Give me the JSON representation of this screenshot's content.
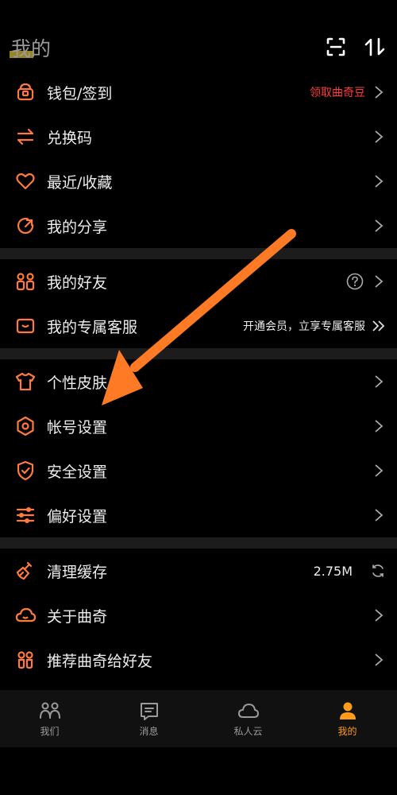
{
  "header": {
    "title": "我的",
    "scan_icon": "scan-icon",
    "sort_icon": "sort-icon"
  },
  "sections": [
    {
      "items": [
        {
          "label": "钱包/签到",
          "icon": "wallet-icon",
          "right_text": "领取曲奇豆"
        },
        {
          "label": "兑换码",
          "icon": "exchange-icon"
        },
        {
          "label": "最近/收藏",
          "icon": "heart-icon"
        },
        {
          "label": "我的分享",
          "icon": "share-icon"
        }
      ]
    },
    {
      "items": [
        {
          "label": "我的好友",
          "icon": "friends-icon",
          "right_icon": "help-icon"
        },
        {
          "label": "我的专属客服",
          "icon": "service-icon",
          "right_text": "开通会员，立享专属客服"
        }
      ]
    },
    {
      "items": [
        {
          "label": "个性皮肤",
          "icon": "shirt-icon"
        },
        {
          "label": "帐号设置",
          "icon": "settings-icon"
        },
        {
          "label": "安全设置",
          "icon": "shield-icon"
        },
        {
          "label": "偏好设置",
          "icon": "sliders-icon"
        }
      ]
    },
    {
      "items": [
        {
          "label": "清理缓存",
          "icon": "broom-icon",
          "right_text": "2.75M"
        },
        {
          "label": "关于曲奇",
          "icon": "cloud-icon"
        },
        {
          "label": "推荐曲奇给好友",
          "icon": "recommend-icon"
        }
      ]
    }
  ],
  "bottom_nav": [
    {
      "label": "我们",
      "icon": "people-icon"
    },
    {
      "label": "消息",
      "icon": "message-icon"
    },
    {
      "label": "私人云",
      "icon": "cloud-icon"
    },
    {
      "label": "我的",
      "icon": "person-icon",
      "active": true
    }
  ],
  "colors": {
    "accent": "#ff9b1a",
    "icon_orange": "#ff7a3d",
    "red_text": "#ff3b3b",
    "annotation_arrow": "#ff7a24"
  }
}
